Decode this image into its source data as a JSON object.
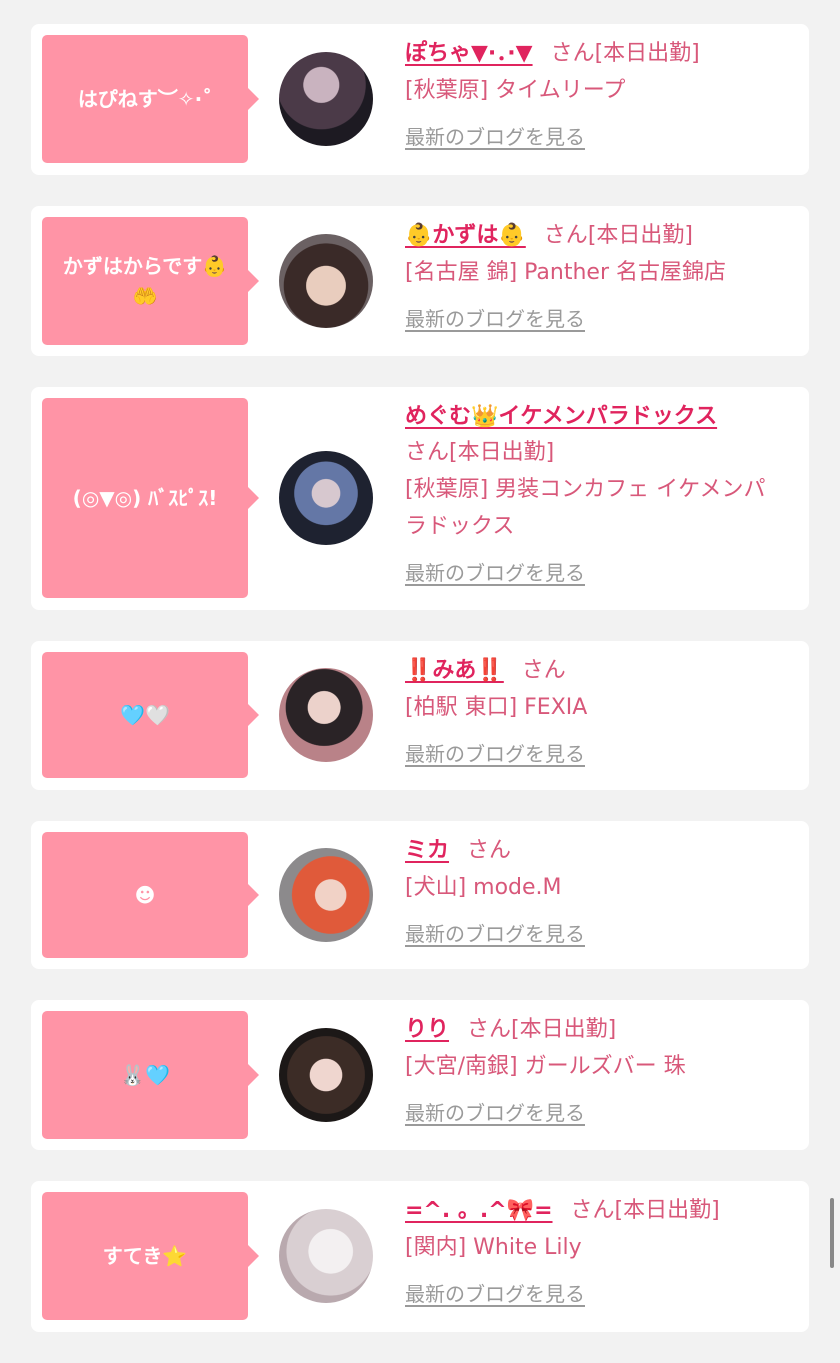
{
  "cards": [
    {
      "bubble": "はぴねす︶✧·˚",
      "name": "ぽちゃ▼·．·▼",
      "san": "さん",
      "today": "[本日出勤]",
      "shop": "[秋葉原] タイムリープ",
      "blog": "最新のブログを見る"
    },
    {
      "bubble": "かずはからです👶\n🤲",
      "name": "👶かずは👶",
      "san": "さん",
      "today": "[本日出勤]",
      "shop": "[名古屋 錦] Panther 名古屋錦店",
      "blog": "最新のブログを見る"
    },
    {
      "bubble": "(◎▼◎) ﾊﾞｽﾋﾟｽ!",
      "name": "めぐむ👑イケメンパラドックス",
      "san": "さん",
      "today": "[本日出勤]",
      "shop": "[秋葉原] 男装コンカフェ イケメンパラドックス",
      "blog": "最新のブログを見る"
    },
    {
      "bubble": "🩵🤍",
      "name": "‼️みあ‼️",
      "san": "さん",
      "today": "",
      "shop": "[柏駅 東口] FEXIA",
      "blog": "最新のブログを見る"
    },
    {
      "bubble": "☻",
      "name": "ミカ",
      "san": "さん",
      "today": "",
      "shop": "[犬山] mode.M",
      "blog": "最新のブログを見る"
    },
    {
      "bubble": "🐰🩵",
      "name": "りり",
      "san": "さん",
      "today": "[本日出勤]",
      "shop": "[大宮/南銀] ガールズバー 珠",
      "blog": "最新のブログを見る"
    },
    {
      "bubble": "すてき⭐",
      "name": "=^. 。.^🎀=",
      "san": "さん",
      "today": "[本日出勤]",
      "shop": "[関内] White Lily",
      "blog": "最新のブログを見る"
    }
  ],
  "colors": {
    "bubble": "#ff94a6",
    "name": "#e0245e",
    "text": "#d8587a",
    "link": "#9a9a9a"
  }
}
